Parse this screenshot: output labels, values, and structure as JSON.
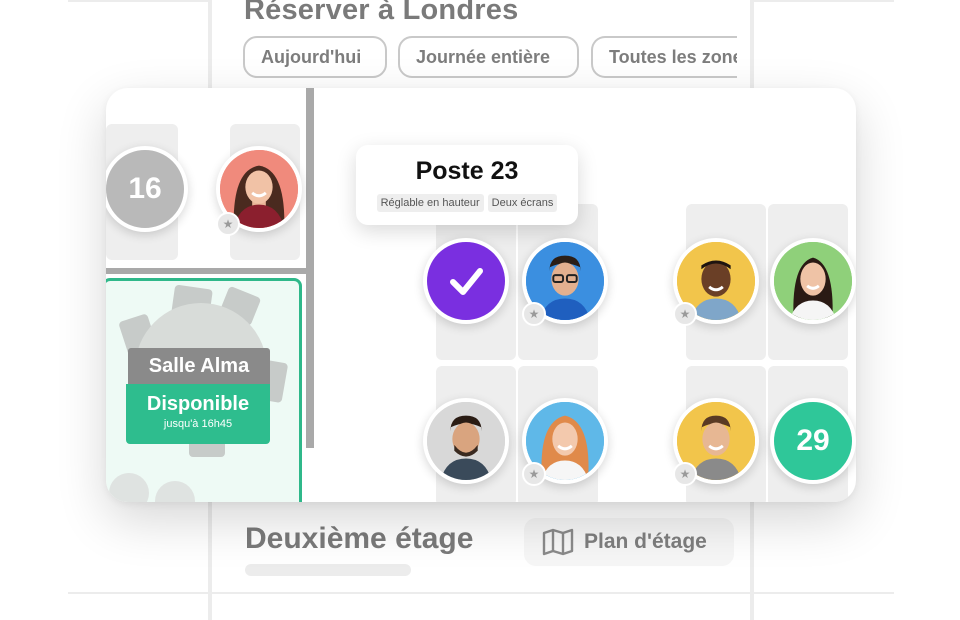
{
  "background": {
    "title": "Réserver à Londres",
    "filters": [
      "Aujourd'hui",
      "Journée entière",
      "Toutes les zones"
    ],
    "floor_title": "Deuxième étage",
    "plan_button_label": "Plan d'étage",
    "plan_icon": "map-icon"
  },
  "map": {
    "room": {
      "name": "Salle Alma",
      "status": "Disponible",
      "until": "jusqu'à 16h45",
      "status_color": "#2ebd8e"
    },
    "tooltip": {
      "title": "Poste 23",
      "tags": [
        "Réglable en hauteur",
        "Deux écrans"
      ]
    },
    "seats": [
      {
        "id": "seat-16",
        "label": "16",
        "kind": "available"
      },
      {
        "id": "seat-occupied-1",
        "kind": "avatar",
        "icon": "user-avatar-icon",
        "favorite": true
      },
      {
        "id": "seat-23",
        "kind": "selected",
        "icon": "checkmark-icon"
      },
      {
        "id": "seat-occupied-2",
        "kind": "avatar",
        "icon": "user-avatar-icon",
        "favorite": true
      },
      {
        "id": "seat-occupied-3",
        "kind": "avatar",
        "icon": "user-avatar-icon",
        "favorite": true
      },
      {
        "id": "seat-occupied-4",
        "kind": "avatar",
        "icon": "user-avatar-icon",
        "favorite": false
      },
      {
        "id": "seat-occupied-5",
        "kind": "avatar",
        "icon": "user-avatar-icon",
        "favorite": false
      },
      {
        "id": "seat-occupied-6",
        "kind": "avatar",
        "icon": "user-avatar-icon",
        "favorite": true
      },
      {
        "id": "seat-occupied-7",
        "kind": "avatar",
        "icon": "user-avatar-icon",
        "favorite": true
      },
      {
        "id": "seat-29",
        "label": "29",
        "kind": "available"
      }
    ]
  },
  "colors": {
    "selected": "#7a2fe0",
    "available_green": "#2fc799",
    "available_grey": "#b9b9b9",
    "room_border": "#2fb88a"
  }
}
